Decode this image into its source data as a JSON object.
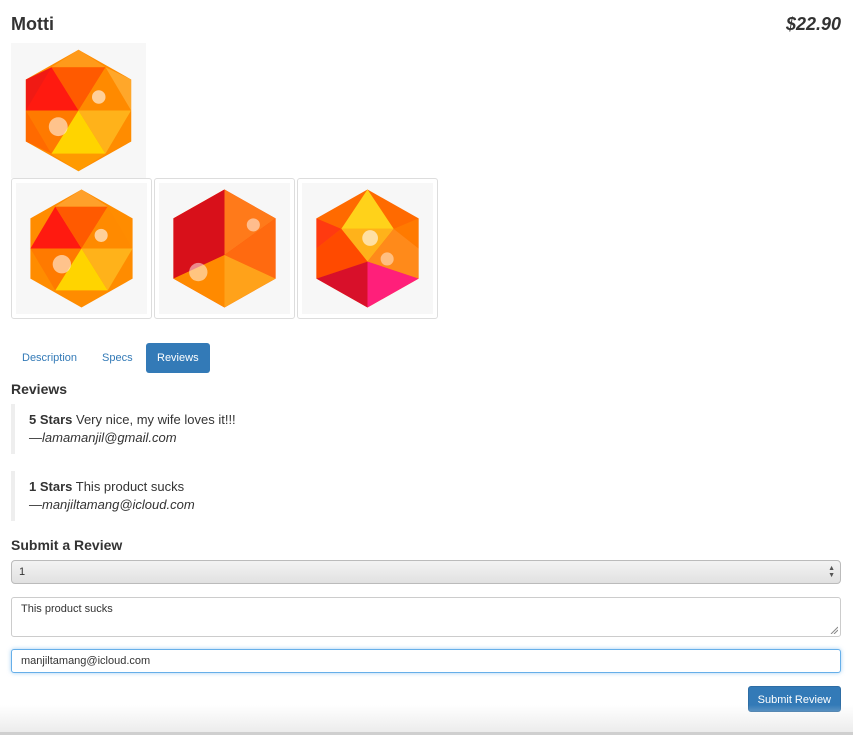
{
  "product": {
    "name": "Motti",
    "price": "$22.90",
    "main_image": "gem-hexagon-orange",
    "thumbnails": [
      "gem-hexagon-orange",
      "gem-hexagon-red",
      "gem-hexagon-pink"
    ]
  },
  "tabs": [
    {
      "label": "Description",
      "active": false
    },
    {
      "label": "Specs",
      "active": false
    },
    {
      "label": "Reviews",
      "active": true
    }
  ],
  "reviews": {
    "heading": "Reviews",
    "items": [
      {
        "stars": "5 Stars",
        "body": "Very nice, my wife loves it!!!",
        "author": "—lamamanjil@gmail.com"
      },
      {
        "stars": "1 Stars",
        "body": "This product sucks",
        "author": "—manjiltamang@icloud.com"
      }
    ]
  },
  "form": {
    "heading": "Submit a Review",
    "rating_value": "1",
    "body_value": "This product sucks",
    "email_value": "manjiltamang@icloud.com",
    "submit_label": "Submit Review"
  },
  "colors": {
    "accent": "#337ab7",
    "gem_orange": "#ff8c00",
    "gem_red": "#e8141e",
    "gem_yellow": "#ffd400",
    "gem_pink": "#ff1f7a"
  }
}
